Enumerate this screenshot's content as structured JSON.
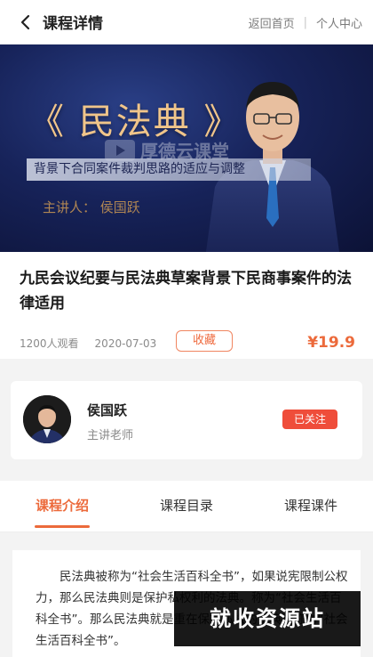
{
  "nav": {
    "title": "课程详情",
    "home_link": "返回首页",
    "separator": "|",
    "profile_link": "个人中心"
  },
  "banner": {
    "big_title": "《 民法典 》",
    "watermark": "厚德云课堂",
    "subtitle": "背景下合同案件裁判思路的适应与调整",
    "speaker": "主讲人：  侯国跃"
  },
  "course": {
    "title": "九民会议纪要与民法典草案背景下民商事案件的法律适用",
    "views": "1200人观看",
    "date": "2020-07-03",
    "favorite_label": "收藏",
    "price": "¥19.9"
  },
  "teacher": {
    "name": "侯国跃",
    "role": "主讲老师",
    "follow_label": "已关注"
  },
  "tabs": [
    {
      "label": "课程介绍",
      "active": true
    },
    {
      "label": "课程目录",
      "active": false
    },
    {
      "label": "课程课件",
      "active": false
    }
  ],
  "intro": {
    "text": "民法典被称为“社会生活百科全书”，如果说宪限制公权力，那么民法典则是保护私权利的法典。称为“社会生活百科全书”。那么民法典就是重在保护私权的法典被称为“社会生活百科全书”。"
  },
  "overlay": {
    "site_mark": "就收资源站"
  },
  "colors": {
    "accent": "#ec6a3b",
    "follow_bg": "#ef4d3a",
    "banner_bg": "#17235a",
    "banner_title": "#f0c58a"
  }
}
